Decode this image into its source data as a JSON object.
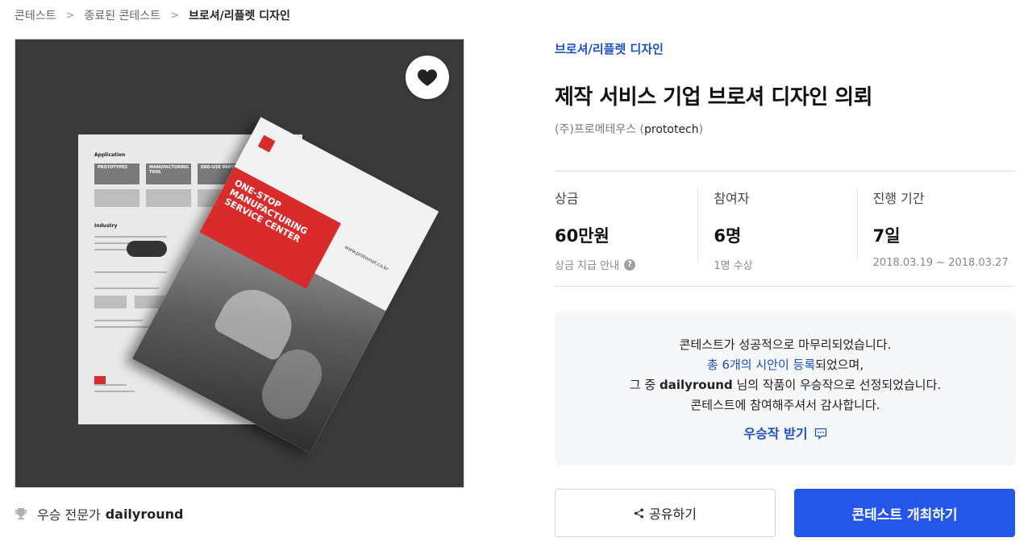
{
  "breadcrumb": {
    "items": [
      "콘테스트",
      "종료된 콘테스트",
      "브로셔/리플렛 디자인"
    ],
    "separator": ">"
  },
  "contest": {
    "category": "브로셔/리플렛 디자인",
    "title": "제작 서비스 기업 브로셔 디자인 의뢰",
    "company_prefix": "(주)프로메테우스 (",
    "company_handle": "prototech",
    "company_suffix": ")"
  },
  "brochure_art": {
    "headline": "ONE-STOP MANUFACTURING SERVICE CENTER",
    "site": "www.protomet.co.kr",
    "section_application": "Application",
    "section_industry": "Industry",
    "cards": [
      "PROTOTYPES",
      "MANUFACTURING TOOL",
      "END-USE PARTS"
    ]
  },
  "stats": {
    "prize": {
      "label": "상금",
      "value": "60만원",
      "sub": "상금 지급 안내",
      "help_icon": "?"
    },
    "participants": {
      "label": "참여자",
      "value": "6명",
      "sub": "1명 수상"
    },
    "period": {
      "label": "진행 기간",
      "value": "7일",
      "sub": "2018.03.19 ~ 2018.03.27"
    }
  },
  "notice": {
    "line1": "콘테스트가 성공적으로 마무리되었습니다.",
    "line2_link": "총 6개의 시안이 등록",
    "line2_rest": "되었으며,",
    "line3_prefix": "그 중 ",
    "line3_name": "dailyround",
    "line3_rest": " 님의 작품이 우승작으로 선정되었습니다.",
    "line4": "콘테스트에 참여해주셔서 감사합니다.",
    "cta": "우승작 받기"
  },
  "expert": {
    "label": "우승 전문가",
    "name": "dailyround"
  },
  "buttons": {
    "share": "공유하기",
    "host": "콘테스트 개최하기"
  },
  "colors": {
    "accent": "#1f4fc7",
    "primary_button": "#2456e8",
    "notice_bg": "#f5f7f9"
  },
  "icons": [
    "heart-icon",
    "trophy-icon",
    "help-icon",
    "message-icon",
    "share-icon",
    "chevron-right-icon"
  ]
}
